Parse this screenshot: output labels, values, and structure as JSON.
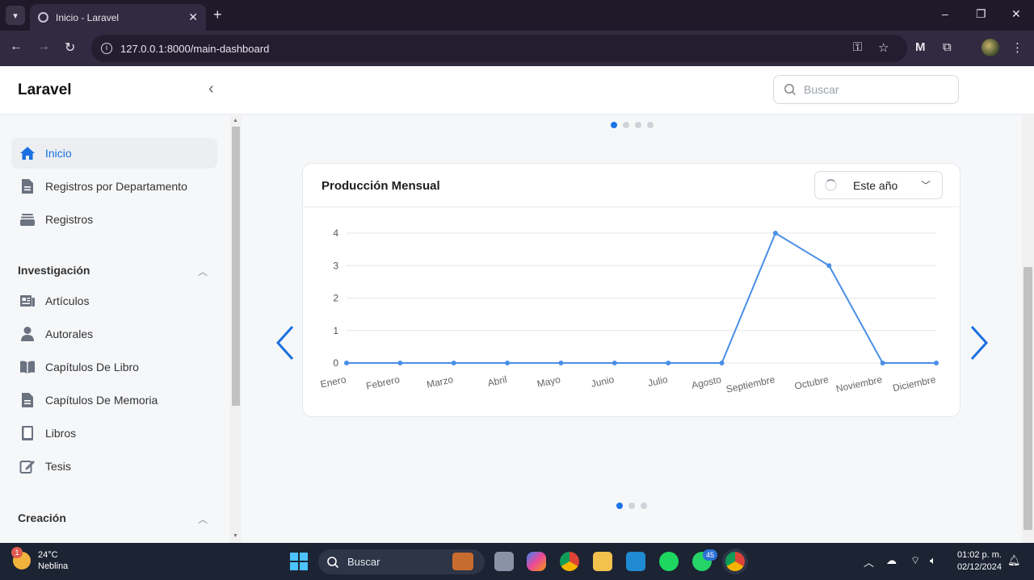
{
  "browser": {
    "tab_title": "Inicio - Laravel",
    "new_tab": "+",
    "url": "127.0.0.1:8000/main-dashboard",
    "window_controls": [
      "–",
      "❐",
      "✕"
    ]
  },
  "app": {
    "brand": "Laravel",
    "search_placeholder": "Buscar"
  },
  "sidebar": {
    "main_items": [
      {
        "label": "Inicio",
        "icon": "home-icon",
        "active": true
      },
      {
        "label": "Registros por Departamento",
        "icon": "document-icon",
        "active": false
      },
      {
        "label": "Registros",
        "icon": "stack-icon",
        "active": false
      }
    ],
    "sections": [
      {
        "title": "Investigación",
        "items": [
          {
            "label": "Artículos",
            "icon": "newspaper-icon"
          },
          {
            "label": "Autorales",
            "icon": "user-icon"
          },
          {
            "label": "Capítulos De Libro",
            "icon": "book-open-icon"
          },
          {
            "label": "Capítulos De Memoria",
            "icon": "document-icon"
          },
          {
            "label": "Libros",
            "icon": "bookmark-icon"
          },
          {
            "label": "Tesis",
            "icon": "edit-icon"
          }
        ]
      },
      {
        "title": "Creación",
        "items": []
      }
    ]
  },
  "chart_card": {
    "title": "Producción Mensual",
    "period_label": "Este año"
  },
  "chart_data": {
    "type": "line",
    "categories": [
      "Enero",
      "Febrero",
      "Marzo",
      "Abril",
      "Mayo",
      "Junio",
      "Julio",
      "Agosto",
      "Septiembre",
      "Octubre",
      "Noviembre",
      "Diciembre"
    ],
    "values": [
      0,
      0,
      0,
      0,
      0,
      0,
      0,
      0,
      4,
      3,
      0,
      0
    ],
    "ylim": [
      0,
      4
    ],
    "yticks": [
      "0",
      "1",
      "2",
      "3",
      "4"
    ],
    "title": "",
    "xlabel": "",
    "ylabel": "",
    "color": "#4a8fe6",
    "grid": true
  },
  "carousel": {
    "top_dots": 4,
    "top_active": 0,
    "bottom_dots": 3,
    "bottom_active": 0
  },
  "taskbar": {
    "weather_temp": "24°C",
    "weather_desc": "Neblina",
    "weather_badge": "1",
    "search_label": "Buscar",
    "whatsapp_badge": "45",
    "time": "01:02 p. m.",
    "date": "02/12/2024"
  }
}
